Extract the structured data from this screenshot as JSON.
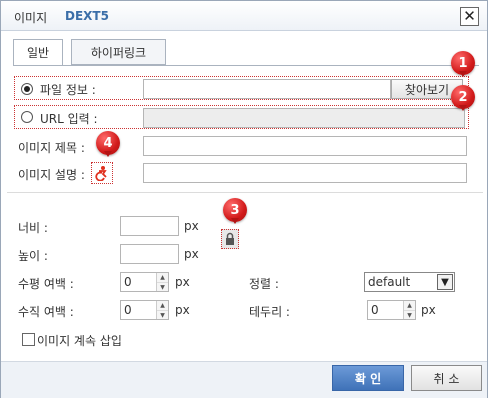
{
  "window": {
    "title": "이미지",
    "brand": "DEXT5",
    "close_icon": "close-icon"
  },
  "tabs": [
    {
      "label": "일반",
      "active": true
    },
    {
      "label": "하이퍼링크",
      "active": false
    }
  ],
  "source": {
    "file_label": "파일 정보 :",
    "file_value": "",
    "browse_button": "찾아보기",
    "url_label": "URL 입력 :",
    "url_value": "",
    "selected": "file"
  },
  "meta": {
    "title_label": "이미지 제목 :",
    "title_value": "",
    "desc_label": "이미지 설명 :",
    "desc_value": "",
    "desc_icon": "accessibility-icon"
  },
  "size": {
    "width_label": "너비 :",
    "width_value": "",
    "height_label": "높이 :",
    "height_value": "",
    "unit": "px",
    "lock_icon": "lock-ratio-icon"
  },
  "spacing": {
    "hspace_label": "수평 여백 :",
    "hspace_value": "0",
    "vspace_label": "수직 여백 :",
    "vspace_value": "0",
    "unit": "px"
  },
  "align": {
    "label": "정렬 :",
    "value": "default"
  },
  "border": {
    "label": "테두리 :",
    "value": "0",
    "unit": "px"
  },
  "continue_insert": {
    "label": "이미지 계속 삽입",
    "checked": false
  },
  "footer": {
    "ok": "확 인",
    "cancel": "취 소"
  },
  "callouts": [
    "1",
    "2",
    "3",
    "4"
  ],
  "colors": {
    "brand": "#3b6ea8",
    "callout": "#d11a1a",
    "ok_button": "#3f72b8"
  }
}
